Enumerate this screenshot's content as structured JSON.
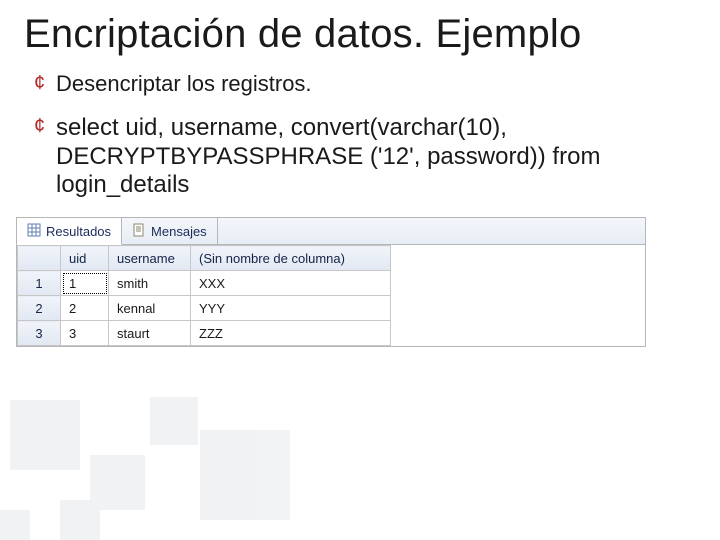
{
  "title": "Encriptación de datos. Ejemplo",
  "bullets": {
    "b1": "Desencriptar los registros.",
    "b2": "select uid, username, convert(varchar(10), DECRYPTBYPASSPHRASE ('12', password)) from login_details"
  },
  "tabs": {
    "results_label": "Resultados",
    "messages_label": "Mensajes"
  },
  "grid": {
    "headers": {
      "uid": "uid",
      "username": "username",
      "col3": "(Sin nombre de columna)"
    },
    "rows": [
      {
        "idx": "1",
        "uid": "1",
        "username": "smith",
        "col3": "XXX"
      },
      {
        "idx": "2",
        "uid": "2",
        "username": "kennal",
        "col3": "YYY"
      },
      {
        "idx": "3",
        "uid": "3",
        "username": "staurt",
        "col3": "ZZZ"
      }
    ]
  }
}
